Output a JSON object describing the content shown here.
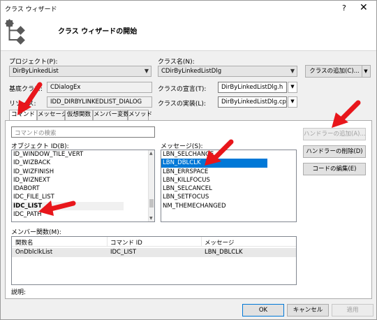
{
  "window": {
    "title": "クラス ウィザード",
    "help": "?",
    "close": "✕",
    "heading": "クラス ウィザードの開始"
  },
  "project": {
    "label": "プロジェクト(P):",
    "value": "DirByLinkedList"
  },
  "classname": {
    "label": "クラス名(N):",
    "value": "CDirByLinkedListDlg"
  },
  "add_class_button": "クラスの追加(C)...",
  "base_class": {
    "label": "基底クラス:",
    "value": "CDialogEx"
  },
  "declaration": {
    "label": "クラスの宣言(T):",
    "value": "DirByLinkedListDlg.h"
  },
  "resource": {
    "label": "リソース:",
    "value": "IDD_DIRBYLINKEDLIST_DIALOG"
  },
  "implementation": {
    "label": "クラスの実装(L):",
    "value": "DirByLinkedListDlg.cpp"
  },
  "tabs": [
    "コマンド",
    "メッセージ",
    "仮想関数",
    "メンバー変数",
    "メソッド"
  ],
  "active_tab": "コマンド",
  "search": {
    "placeholder": "コマンドの検索"
  },
  "object_ids": {
    "label": "オブジェクト ID(B):",
    "items": [
      "ID_WINDOW_TILE_VERT",
      "ID_WIZBACK",
      "ID_WIZFINISH",
      "ID_WIZNEXT",
      "IDABORT",
      "IDC_FILE_LIST",
      "IDC_LIST",
      "IDC_PATH"
    ],
    "selected": "IDC_LIST"
  },
  "messages": {
    "label": "メッセージ(S):",
    "items": [
      "LBN_SELCHANGE",
      "LBN_DBLCLK",
      "LBN_ERRSPACE",
      "LBN_KILLFOCUS",
      "LBN_SELCANCEL",
      "LBN_SETFOCUS",
      "NM_THEMECHANGED"
    ],
    "selected": "LBN_DBLCLK"
  },
  "handler_buttons": {
    "add": "ハンドラーの追加(A)...",
    "delete": "ハンドラーの削除(D)",
    "edit": "コードの編集(E)"
  },
  "member_functions": {
    "label": "メンバー関数(M):",
    "columns": [
      "関数名",
      "コマンド ID",
      "メッセージ"
    ],
    "rows": [
      [
        "OnDblclkList",
        "IDC_LIST",
        "LBN_DBLCLK"
      ]
    ]
  },
  "description_label": "説明:",
  "footer": {
    "ok": "OK",
    "cancel": "キャンセル",
    "apply": "適用"
  },
  "colors": {
    "selection": "#0078d7",
    "annotation_arrow": "#e8161b"
  }
}
